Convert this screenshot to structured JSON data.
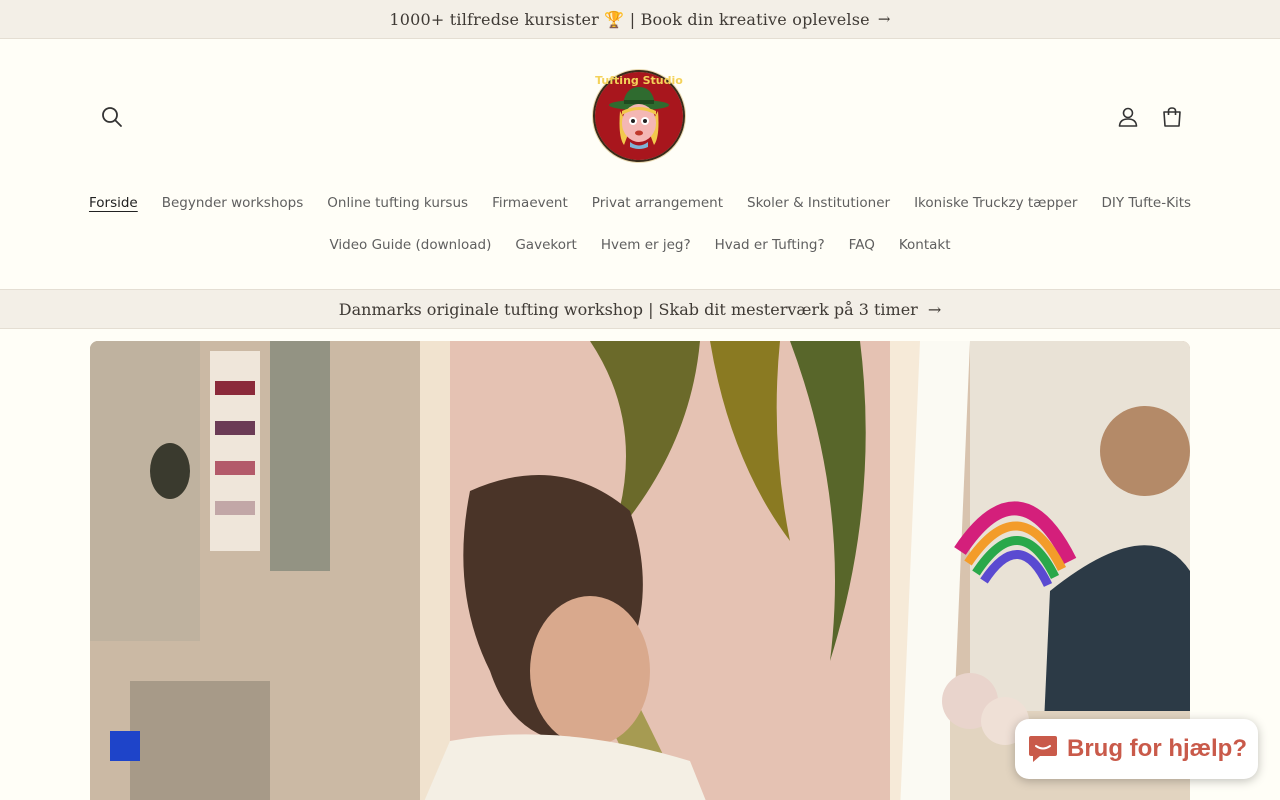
{
  "announcement": {
    "text": "1000+ tilfredse kursister 🏆 | Book din kreative oplevelse",
    "arrow": "→"
  },
  "header": {
    "logo_alt": "Tufting Studio",
    "icons": [
      "search-icon",
      "account-icon",
      "cart-icon"
    ]
  },
  "nav": {
    "row1": [
      "Forside",
      "Begynder workshops",
      "Online tufting kursus",
      "Firmaevent",
      "Privat arrangement",
      "Skoler & Institutioner",
      "Ikoniske Truckzy tæpper",
      "DIY Tufte-Kits"
    ],
    "row2": [
      "Video Guide (download)",
      "Gavekort",
      "Hvem er jeg?",
      "Hvad er Tufting?",
      "FAQ",
      "Kontakt"
    ],
    "active": "Forside"
  },
  "banner": {
    "text": "Danmarks originale tufting workshop | Skab dit mesterværk på 3 timer",
    "arrow": "→"
  },
  "chat": {
    "label": "Brug for hjælp?",
    "icon": "chat-bubble-icon"
  },
  "colors": {
    "background": "#fffef7",
    "bar": "#f3efe7",
    "accent": "#c95a4a"
  }
}
